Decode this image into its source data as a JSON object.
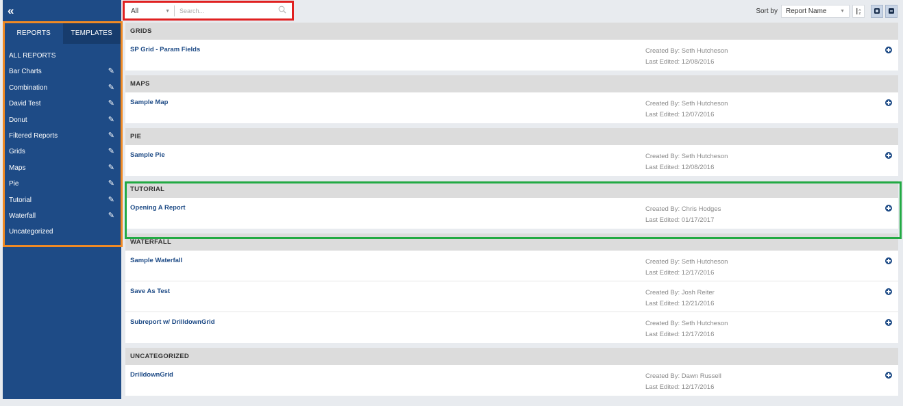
{
  "sidebar": {
    "collapse_icon": "double-chevron-left-icon",
    "tabs": [
      {
        "label": "REPORTS"
      },
      {
        "label": "TEMPLATES"
      }
    ],
    "all_reports": "ALL REPORTS",
    "items": [
      {
        "label": "Bar Charts",
        "editable": true
      },
      {
        "label": "Combination",
        "editable": true
      },
      {
        "label": "David Test",
        "editable": true
      },
      {
        "label": "Donut",
        "editable": true
      },
      {
        "label": "Filtered Reports",
        "editable": true
      },
      {
        "label": "Grids",
        "editable": true
      },
      {
        "label": "Maps",
        "editable": true
      },
      {
        "label": "Pie",
        "editable": true
      },
      {
        "label": "Tutorial",
        "editable": true
      },
      {
        "label": "Waterfall",
        "editable": true
      },
      {
        "label": "Uncategorized",
        "editable": false
      }
    ]
  },
  "search": {
    "filter_value": "All",
    "placeholder": "Search..."
  },
  "sort": {
    "label": "Sort by",
    "value": "Report Name",
    "order_icon": "sort-az-icon"
  },
  "groups": [
    {
      "title": "GRIDS",
      "reports": [
        {
          "name": "SP Grid - Param Fields",
          "created_by": "Created By:  Seth Hutcheson",
          "last_edited": "Last Edited:  12/08/2016"
        }
      ]
    },
    {
      "title": "MAPS",
      "reports": [
        {
          "name": "Sample Map",
          "created_by": "Created By:  Seth Hutcheson",
          "last_edited": "Last Edited:  12/07/2016"
        }
      ]
    },
    {
      "title": "PIE",
      "reports": [
        {
          "name": "Sample Pie",
          "created_by": "Created By:  Seth Hutcheson",
          "last_edited": "Last Edited:  12/08/2016"
        }
      ]
    },
    {
      "title": "TUTORIAL",
      "reports": [
        {
          "name": "Opening A Report",
          "created_by": "Created By:  Chris Hodges",
          "last_edited": "Last Edited:  01/17/2017"
        }
      ]
    },
    {
      "title": "WATERFALL",
      "reports": [
        {
          "name": "Sample Waterfall",
          "created_by": "Created By:  Seth Hutcheson",
          "last_edited": "Last Edited:  12/17/2016"
        },
        {
          "name": "Save As Test",
          "created_by": "Created By:  Josh Reiter",
          "last_edited": "Last Edited:  12/21/2016"
        },
        {
          "name": "Subreport w/ DrilldownGrid",
          "created_by": "Created By:  Seth Hutcheson",
          "last_edited": "Last Edited:  12/17/2016"
        }
      ]
    },
    {
      "title": "UNCATEGORIZED",
      "reports": [
        {
          "name": "DrilldownGrid",
          "created_by": "Created By:  Dawn Russell",
          "last_edited": "Last Edited:  12/17/2016"
        }
      ]
    }
  ],
  "colors": {
    "sidebar_bg": "#1e4b86",
    "accent": "#1e4b86",
    "highlight_search": "#e02020",
    "highlight_sidebar": "#f08a24",
    "highlight_tutorial": "#22aa44"
  }
}
